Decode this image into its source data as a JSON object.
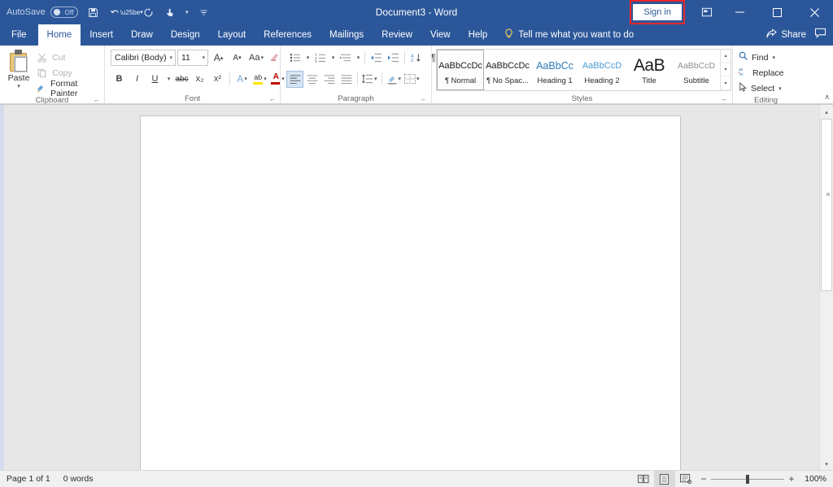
{
  "titlebar": {
    "autosave_label": "AutoSave",
    "autosave_state": "Off",
    "document_title": "Document3  -  Word",
    "quick_access": [
      {
        "name": "save-icon",
        "glyph": "⬚"
      },
      {
        "name": "undo-icon",
        "glyph": "↶"
      },
      {
        "name": "redo-icon",
        "glyph": "↻"
      },
      {
        "name": "touch-mode-icon",
        "glyph": "☝"
      },
      {
        "name": "customize-quick-access-toolbar-icon",
        "glyph": "≣"
      }
    ],
    "sign_in_label": "Sign in",
    "ribbon_display_options": "⧉",
    "minimize": "─",
    "maximize": "□",
    "close": "✕",
    "highlight_color": "#e8262a",
    "brand_color": "#2b579a"
  },
  "tabs": [
    {
      "label": "File",
      "active": false
    },
    {
      "label": "Home",
      "active": true
    },
    {
      "label": "Insert",
      "active": false
    },
    {
      "label": "Draw",
      "active": false
    },
    {
      "label": "Design",
      "active": false
    },
    {
      "label": "Layout",
      "active": false
    },
    {
      "label": "References",
      "active": false
    },
    {
      "label": "Mailings",
      "active": false
    },
    {
      "label": "Review",
      "active": false
    },
    {
      "label": "View",
      "active": false
    },
    {
      "label": "Help",
      "active": false
    }
  ],
  "tellme": {
    "placeholder": "Tell me what you want to do",
    "icon": "💡"
  },
  "share": {
    "label": "Share",
    "comments_icon": "🗪"
  },
  "ribbon": {
    "clipboard": {
      "group_label": "Clipboard",
      "paste_label": "Paste",
      "items": [
        {
          "label": "Cut",
          "icon": "✂",
          "disabled": true
        },
        {
          "label": "Copy",
          "icon": "⧉",
          "disabled": true
        },
        {
          "label": "Format Painter",
          "icon": "🖌",
          "disabled": false
        }
      ]
    },
    "font": {
      "group_label": "Font",
      "font_name": "Calibri (Body)",
      "font_size": "11",
      "grow_font": "A",
      "shrink_font": "A",
      "change_case": "Aa",
      "clear_formatting": "🖌",
      "bold": "B",
      "italic": "I",
      "underline": "U",
      "strikethrough": "abc",
      "subscript": "x₂",
      "superscript": "x²",
      "text_effects": "A",
      "highlight": "ab",
      "font_color": "A",
      "highlight_color": "#ffe400",
      "font_color_swatch": "#c00000"
    },
    "paragraph": {
      "group_label": "Paragraph",
      "bullets": "☰",
      "numbering": "☰",
      "multilevel": "☰",
      "decrease_indent": "⇤",
      "increase_indent": "⇥",
      "sort": "↕",
      "show_marks": "¶",
      "align_left": "☰",
      "align_center": "☰",
      "align_right": "☰",
      "justify": "☰",
      "line_spacing": "↕",
      "shading": "■",
      "borders": "▦"
    },
    "styles": {
      "group_label": "Styles",
      "items": [
        {
          "preview": "AaBbCcDc",
          "name": "¶ Normal",
          "kind": "normal",
          "selected": true
        },
        {
          "preview": "AaBbCcDc",
          "name": "¶ No Spac...",
          "kind": "normal",
          "selected": false
        },
        {
          "preview": "AaBbCc",
          "name": "Heading 1",
          "kind": "h1",
          "selected": false
        },
        {
          "preview": "AaBbCcD",
          "name": "Heading 2",
          "kind": "h2",
          "selected": false
        },
        {
          "preview": "AaB",
          "name": "Title",
          "kind": "title",
          "selected": false
        },
        {
          "preview": "AaBbCcD",
          "name": "Subtitle",
          "kind": "sub",
          "selected": false
        }
      ],
      "scroll_up": "▴",
      "scroll_down": "▾",
      "more": "▾"
    },
    "editing": {
      "group_label": "Editing",
      "items": [
        {
          "label": "Find",
          "icon": "🔍",
          "caret": true
        },
        {
          "label": "Replace",
          "icon": "ab",
          "caret": false
        },
        {
          "label": "Select",
          "icon": "↖",
          "caret": true
        }
      ]
    },
    "collapse_icon": "∧",
    "dialog_launcher": "⤵"
  },
  "document": {
    "page_background": "#ffffff",
    "canvas_background": "#e7e7e7"
  },
  "scrollbar": {
    "up_arrow": "▴",
    "down_arrow": "▾"
  },
  "statusbar": {
    "page_info": "Page 1 of 1",
    "word_count": "0 words",
    "views": [
      {
        "name": "read-mode",
        "icon": "📖",
        "active": false
      },
      {
        "name": "print-layout",
        "icon": "☰",
        "active": true
      },
      {
        "name": "web-layout",
        "icon": "☷",
        "active": false
      }
    ],
    "zoom_out": "−",
    "zoom_in": "+",
    "zoom_level": "100%"
  }
}
